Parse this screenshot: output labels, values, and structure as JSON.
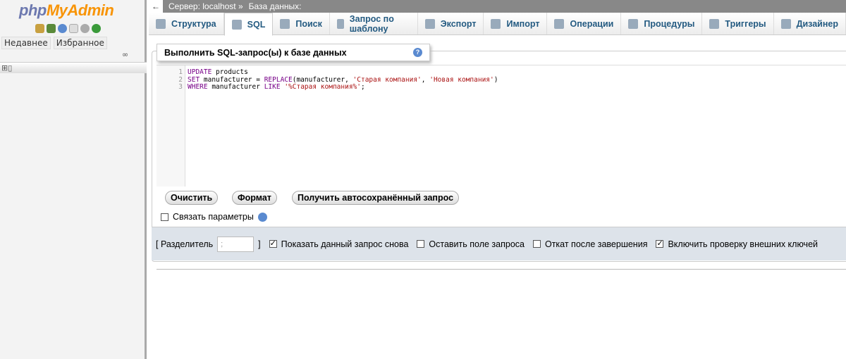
{
  "sidebar": {
    "logo": {
      "a": "php",
      "b": "MyAdmin"
    },
    "icons": [
      "home-icon",
      "exit-icon",
      "help-icon",
      "docs-icon",
      "settings-icon",
      "reload-icon"
    ],
    "tabs": [
      "Недавнее",
      "Избранное"
    ],
    "link_icon": "link-icon"
  },
  "topbar": {
    "back": "←",
    "server": "Сервер: localhost »",
    "database": "База данных:"
  },
  "tabs": [
    {
      "label": "Структура",
      "icon": "structure-icon"
    },
    {
      "label": "SQL",
      "icon": "sql-icon",
      "active": true
    },
    {
      "label": "Поиск",
      "icon": "search-icon"
    },
    {
      "label": "Запрос по шаблону",
      "icon": "query-icon"
    },
    {
      "label": "Экспорт",
      "icon": "export-icon"
    },
    {
      "label": "Импорт",
      "icon": "import-icon"
    },
    {
      "label": "Операции",
      "icon": "operations-icon"
    },
    {
      "label": "Процедуры",
      "icon": "routines-icon"
    },
    {
      "label": "Триггеры",
      "icon": "triggers-icon"
    },
    {
      "label": "Дизайнер",
      "icon": "designer-icon"
    }
  ],
  "panel": {
    "title": "Выполнить SQL-запрос(ы) к базе данных"
  },
  "editor": {
    "lines": [
      "1",
      "2",
      "3"
    ],
    "l1": {
      "k1": "UPDATE",
      "t1": " products"
    },
    "l2": {
      "k1": "SET",
      "t1": " manufacturer = ",
      "k2": "REPLACE",
      "t2": "(manufacturer, ",
      "s1": "'Старая компания'",
      "t3": ", ",
      "s2": "'Новая компания'",
      "t4": ")"
    },
    "l3": {
      "k1": "WHERE",
      "t1": " manufacturer ",
      "k2": "LIKE",
      "t2": " ",
      "s1": "'%Старая компания%'",
      "t3": ";"
    }
  },
  "buttons": {
    "clear": "Очистить",
    "format": "Формат",
    "autosave": "Получить автосохранённый запрос"
  },
  "bind_params": {
    "label": "Связать параметры",
    "checked": false
  },
  "options": {
    "delimiter_label": "[ Разделитель",
    "delimiter_value": ";",
    "delimiter_close": "]",
    "show_again": {
      "label": "Показать данный запрос снова",
      "checked": true
    },
    "keep_box": {
      "label": "Оставить поле запроса",
      "checked": false
    },
    "rollback": {
      "label": "Откат после завершения",
      "checked": false
    },
    "fk_checks": {
      "label": "Включить проверку внешних ключей",
      "checked": true
    }
  }
}
